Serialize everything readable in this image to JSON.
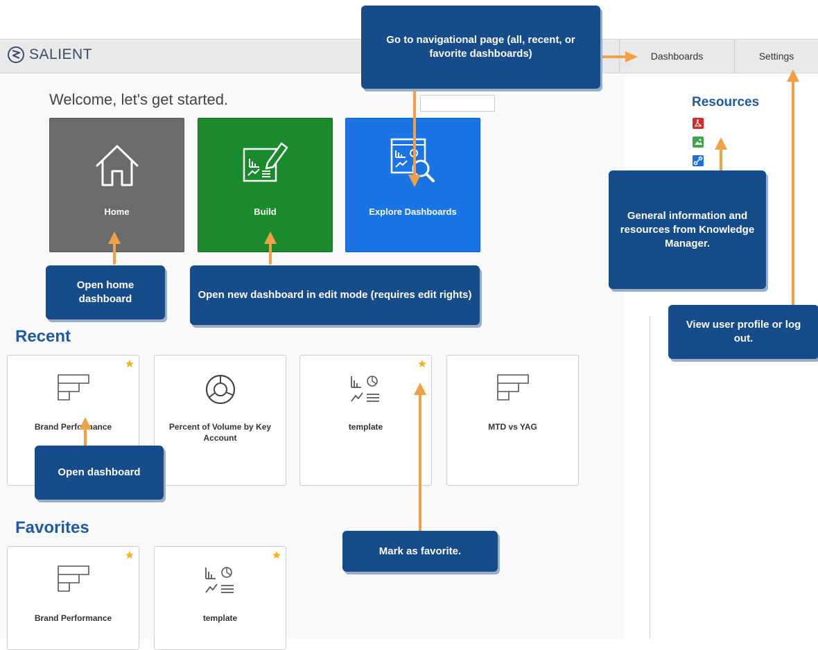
{
  "app": {
    "logo_text": "SALIENT"
  },
  "nav": {
    "dashboards": "Dashboards",
    "settings": "Settings"
  },
  "welcome": "Welcome, let's get started.",
  "tiles": {
    "home": "Home",
    "build": "Build",
    "explore": "Explore Dashboards"
  },
  "sections": {
    "recent": "Recent",
    "favorites": "Favorites"
  },
  "recent": [
    {
      "name": "Brand Performance",
      "icon": "bar-chart-icon",
      "favorite": true
    },
    {
      "name": "Percent of Volume by Key Account",
      "icon": "donut-chart-icon",
      "favorite": false
    },
    {
      "name": "template",
      "icon": "template-icon",
      "favorite": true
    },
    {
      "name": "MTD vs YAG",
      "icon": "bar-chart-icon",
      "favorite": false
    }
  ],
  "favorites": [
    {
      "name": "Brand Performance",
      "icon": "bar-chart-icon",
      "favorite": true
    },
    {
      "name": "template",
      "icon": "template-icon",
      "favorite": true
    }
  ],
  "resources": {
    "title": "Resources",
    "icons": [
      "pdf-icon",
      "image-icon",
      "link-icon"
    ]
  },
  "callouts": {
    "nav": "Go to navigational page (all, recent, or favorite dashboards)",
    "home": "Open home dashboard",
    "build": "Open new dashboard in  edit mode (requires edit rights)",
    "resources": "General information and resources from Knowledge Manager.",
    "profile": "View user profile or log out.",
    "open": "Open dashboard",
    "favorite": "Mark as favorite."
  },
  "colors": {
    "accent": "#1f5aa6",
    "callout": "#164c8a",
    "arrow": "#f0a046",
    "star": "#f6b21b"
  }
}
